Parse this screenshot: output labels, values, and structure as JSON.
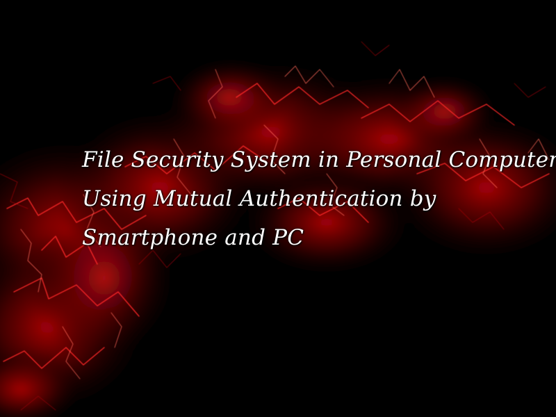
{
  "slide": {
    "title_lines": [
      "File Security System in Personal Computer",
      "Using Mutual Authentication by",
      "Smartphone and PC"
    ]
  },
  "colors": {
    "background": "#000000",
    "glow": "#c0000a",
    "text": "#ffffff"
  },
  "background": {
    "icon": "red-fractal-lightning-artwork"
  }
}
